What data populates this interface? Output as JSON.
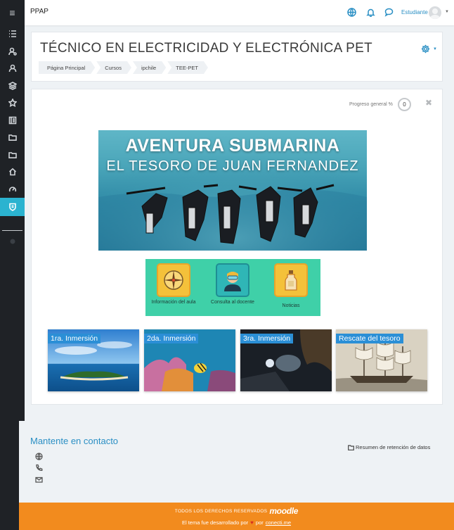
{
  "navbar": {
    "brand": "PPAP",
    "user_name": "Estudiante",
    "icons": [
      "globe-icon",
      "bell-icon",
      "chat-icon"
    ]
  },
  "sidebar": {
    "items": [
      "menu-icon",
      "list-icon",
      "user-settings-icon",
      "users-icon",
      "layers-icon",
      "star-icon",
      "book-icon",
      "folder-icon",
      "folder-icon",
      "home-icon",
      "dashboard-icon",
      "shield-icon"
    ],
    "active_color": "#2bb3d0"
  },
  "header": {
    "title": "TÉCNICO EN ELECTRICIDAD Y ELECTRÓNICA PET",
    "breadcrumb": [
      "Página Principal",
      "Cursos",
      "ipchile",
      "TEE-PET"
    ]
  },
  "main": {
    "progress_label": "Progreso general %",
    "progress_value": "0",
    "banner": {
      "title": "AVENTURA SUBMARINA",
      "subtitle": "EL TESORO DE JUAN FERNANDEZ"
    },
    "panel": {
      "items": [
        {
          "label": "Información del aula",
          "icon": "compass-icon"
        },
        {
          "label": "Consulta al docente",
          "icon": "diver-icon"
        },
        {
          "label": "Noticias",
          "icon": "bottle-icon"
        }
      ],
      "bg_color": "#3fd0a8"
    },
    "tiles": [
      {
        "label": "1ra. Inmersión"
      },
      {
        "label": "2da. Inmersión"
      },
      {
        "label": "3ra. Inmersión"
      },
      {
        "label": "Rescate del tesoro"
      }
    ]
  },
  "footer": {
    "contact_title": "Mantente en contacto",
    "retention_link": "Resumen de retención de datos",
    "copyright": "TODOS LOS DERECHOS RESERVADOS",
    "moodle": "moodle",
    "developed_by": "El tema fue desarrollado por",
    "por": "por",
    "link": "conecti.me",
    "accent": "#f28b1e"
  }
}
